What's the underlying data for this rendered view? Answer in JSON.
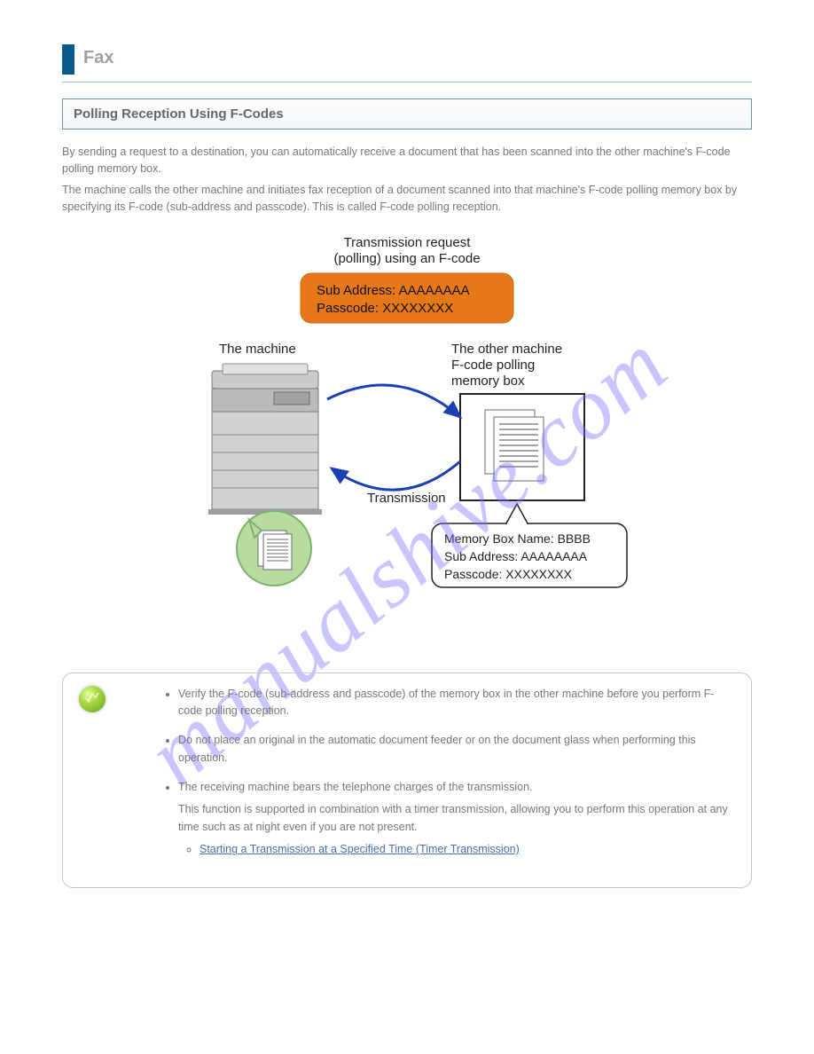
{
  "header": {
    "title": "Fax"
  },
  "section_title": "Polling Reception Using F-Codes",
  "intro": {
    "p1": "By sending a request to a destination, you can automatically receive a document that has been scanned into the other machine's F-code polling memory box.",
    "p2": "The machine calls the other machine and initiates fax reception of a document scanned into that machine's F-code polling memory box by specifying its F-code (sub-address and passcode). This is called F-code polling reception."
  },
  "figure": {
    "caption_top": "Transmission request\n(polling) using an F-code",
    "orange_sub": "Sub Address: AAAAAAAA",
    "orange_pass": "Passcode: XXXXXXXX",
    "left_label": "The machine",
    "right_label": "The other machine\nF-code polling\nmemory box",
    "bottom_label": "Transmission",
    "callout_name": "Memory Box Name: BBBB",
    "callout_sub": "Sub Address: AAAAAAAA",
    "callout_pass": "Passcode: XXXXXXXX"
  },
  "notes": {
    "n1": "Verify the F-code (sub-address and passcode) of the memory box in the other machine before you perform F-code polling reception.",
    "n2": "Do not place an original in the automatic document feeder or on the document glass when performing this operation.",
    "n3": "The receiving machine bears the telephone charges of the transmission.",
    "n3_lead": "This function is supported in combination with a timer transmission, allowing you to perform this operation at any time such as at night even if you are not present.",
    "link_text": "Starting a Transmission at a Specified Time (Timer Transmission)"
  },
  "watermark": "manualshive.com"
}
